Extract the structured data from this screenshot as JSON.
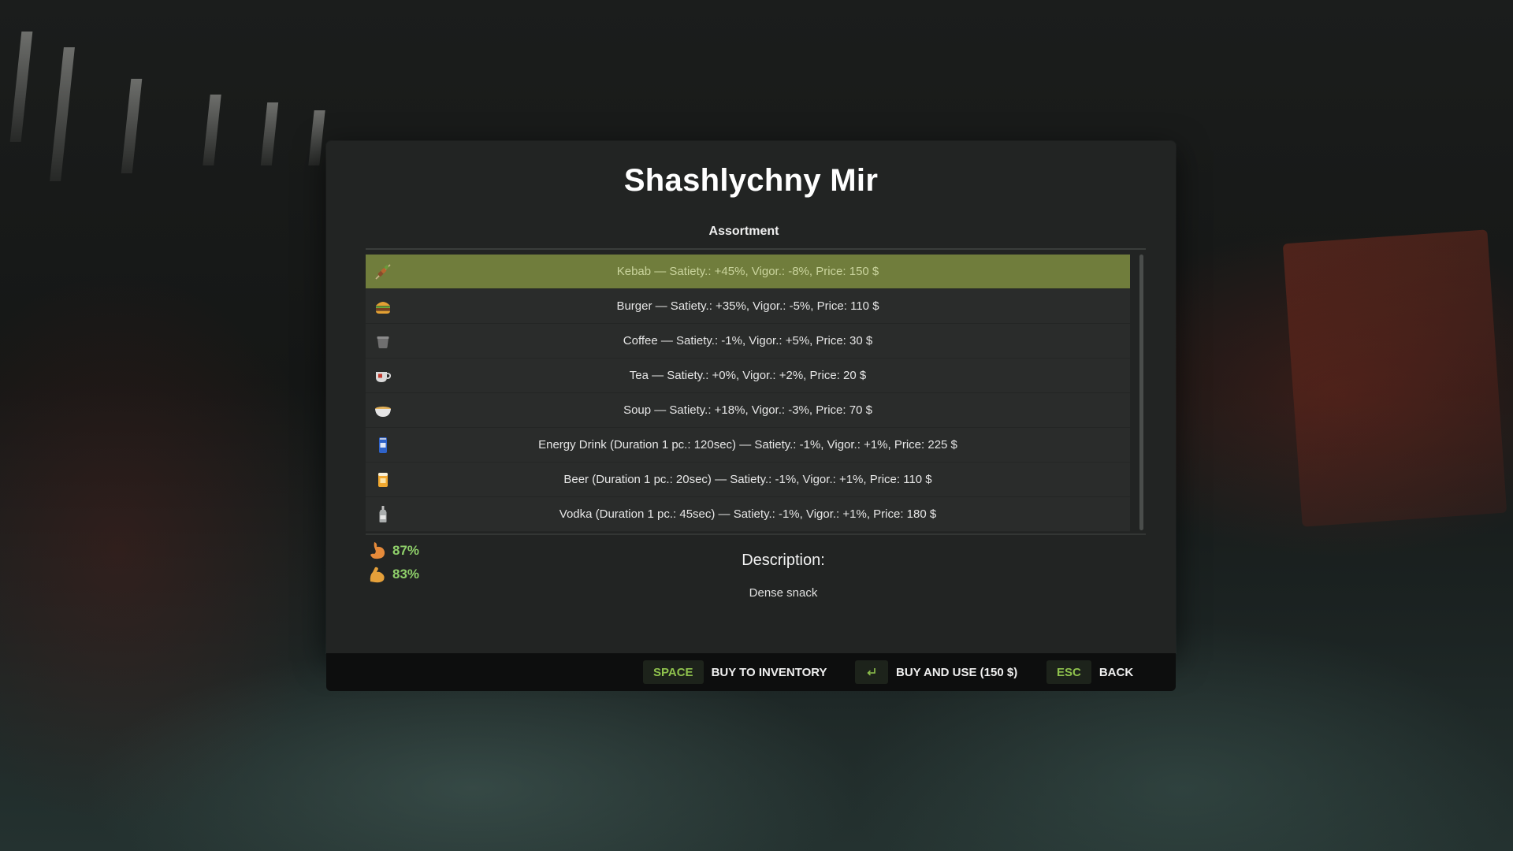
{
  "shop": {
    "title": "Shashlychny Mir",
    "section_label": "Assortment",
    "items": [
      {
        "icon": "kebab-icon",
        "label": "Kebab — Satiety.: +45%, Vigor.: -8%, Price: 150 $",
        "selected": true
      },
      {
        "icon": "burger-icon",
        "label": "Burger — Satiety.: +35%, Vigor.: -5%, Price: 110 $",
        "selected": false
      },
      {
        "icon": "coffee-cup-icon",
        "label": "Coffee — Satiety.: -1%, Vigor.: +5%, Price: 30 $",
        "selected": false
      },
      {
        "icon": "tea-cup-icon",
        "label": "Tea — Satiety.: +0%, Vigor.: +2%, Price: 20 $",
        "selected": false
      },
      {
        "icon": "soup-bowl-icon",
        "label": "Soup — Satiety.: +18%, Vigor.: -3%, Price: 70 $",
        "selected": false
      },
      {
        "icon": "energy-drink-can-icon",
        "label": "Energy Drink (Duration 1 pc.: 120sec) — Satiety.: -1%, Vigor.: +1%, Price: 225 $",
        "selected": false
      },
      {
        "icon": "beer-mug-icon",
        "label": "Beer (Duration 1 pc.: 20sec) — Satiety.: -1%, Vigor.: +1%, Price: 110 $",
        "selected": false
      },
      {
        "icon": "vodka-bottle-icon",
        "label": "Vodka (Duration 1 pc.: 45sec) — Satiety.: -1%, Vigor.: +1%, Price: 180 $",
        "selected": false
      }
    ]
  },
  "stats": {
    "satiety": {
      "icon": "stomach-icon",
      "value": "87%"
    },
    "vigor": {
      "icon": "flexed-arm-icon",
      "value": "83%"
    }
  },
  "description": {
    "title": "Description:",
    "text": "Dense snack"
  },
  "footer": {
    "buy_key": "SPACE",
    "buy_label": "BUY TO INVENTORY",
    "use_key_icon": "enter-key-icon",
    "use_label": "BUY AND USE (150 $)",
    "back_key": "ESC",
    "back_label": "BACK"
  },
  "colors": {
    "selected_row": "#707d3c",
    "stat_value": "#8fd06a",
    "key_text": "#8fc24d"
  }
}
